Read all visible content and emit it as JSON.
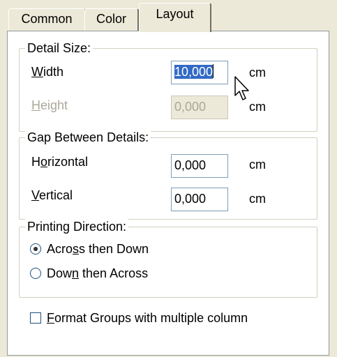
{
  "tabs": [
    {
      "label": "Common",
      "active": false
    },
    {
      "label": "Color",
      "active": false
    },
    {
      "label": "Layout",
      "active": true
    }
  ],
  "detail_size": {
    "legend": "Detail Size:",
    "width_label": "Width",
    "width_value": "10,000",
    "width_unit": "cm",
    "height_label": "Height",
    "height_value": "0,000",
    "height_unit": "cm"
  },
  "gap_between_details": {
    "legend": "Gap Between Details:",
    "horizontal_label": "Horizontal",
    "horizontal_value": "0,000",
    "horizontal_unit": "cm",
    "vertical_label": "Vertical",
    "vertical_value": "0,000",
    "vertical_unit": "cm"
  },
  "printing_direction": {
    "legend": "Printing Direction:",
    "options": [
      {
        "label": "Across then Down",
        "selected": true
      },
      {
        "label": "Down then Across",
        "selected": false
      }
    ]
  },
  "format_groups": {
    "label": "Format Groups with multiple column",
    "checked": false
  },
  "colors": {
    "selection": "#316ac5",
    "disabled_text": "#aca899",
    "dialog_bg": "#ece9d8"
  }
}
